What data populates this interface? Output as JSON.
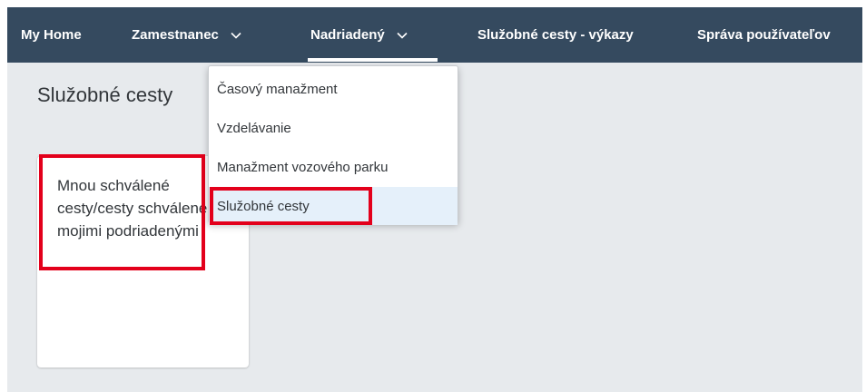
{
  "colors": {
    "shell_bar": "#354a5f",
    "page_background": "#e7eaed",
    "highlight_red": "#e3001b",
    "menu_selected": "#e5f0fa",
    "text": "#32363a"
  },
  "navbar": {
    "items": [
      {
        "label": "My Home"
      },
      {
        "label": "Zamestnanec",
        "icon": "chevron-down-icon"
      },
      {
        "label": "Nadriadený",
        "icon": "chevron-down-icon",
        "active": true
      },
      {
        "label": "Služobné cesty - výkazy"
      },
      {
        "label": "Správa používateľov"
      }
    ]
  },
  "page": {
    "title": "Služobné cesty"
  },
  "tile": {
    "title": "Mnou schválené cesty/cesty schválené mojimi podriadenými"
  },
  "dropdown": {
    "items": [
      {
        "label": "Časový manažment"
      },
      {
        "label": "Vzdelávanie"
      },
      {
        "label": "Manažment vozového parku"
      },
      {
        "label": "Služobné cesty",
        "selected": true
      }
    ]
  }
}
